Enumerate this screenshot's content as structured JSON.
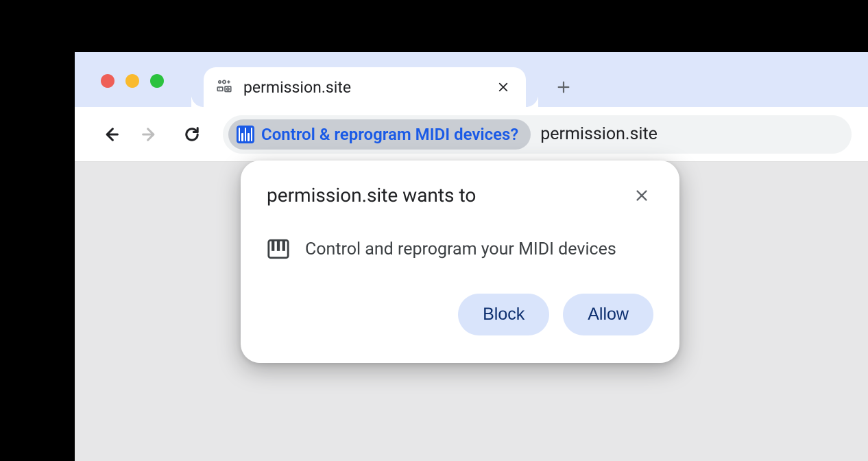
{
  "tab": {
    "title": "permission.site"
  },
  "omnibox": {
    "chip_label": "Control & reprogram MIDI devices?",
    "url": "permission.site"
  },
  "popup": {
    "title": "permission.site wants to",
    "permission_text": "Control and reprogram your MIDI devices",
    "block_label": "Block",
    "allow_label": "Allow"
  }
}
